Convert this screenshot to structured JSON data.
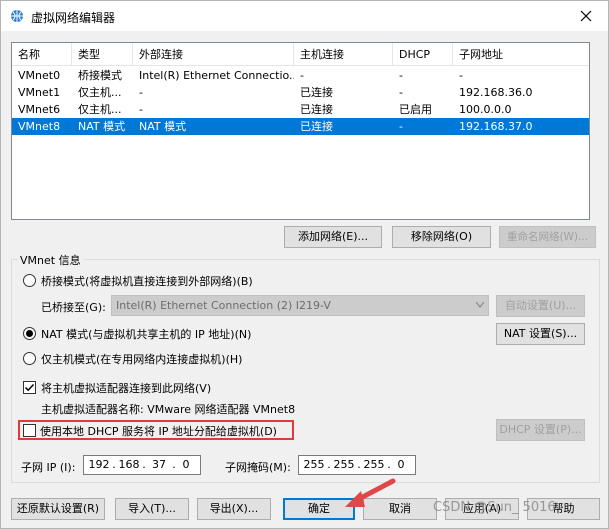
{
  "window": {
    "title": "虚拟网络编辑器"
  },
  "list": {
    "columns": [
      "名称",
      "类型",
      "外部连接",
      "主机连接",
      "DHCP",
      "子网地址"
    ],
    "rows": [
      {
        "name": "VMnet0",
        "type": "桥接模式",
        "external": "Intel(R) Ethernet Connectio...",
        "host": "-",
        "dhcp": "-",
        "subnet": "-",
        "selected": false
      },
      {
        "name": "VMnet1",
        "type": "仅主机...",
        "external": "-",
        "host": "已连接",
        "dhcp": "-",
        "subnet": "192.168.36.0",
        "selected": false
      },
      {
        "name": "VMnet6",
        "type": "仅主机...",
        "external": "-",
        "host": "已连接",
        "dhcp": "已启用",
        "subnet": "100.0.0.0",
        "selected": false
      },
      {
        "name": "VMnet8",
        "type": "NAT 模式",
        "external": "NAT 模式",
        "host": "已连接",
        "dhcp": "-",
        "subnet": "192.168.37.0",
        "selected": true
      }
    ]
  },
  "list_buttons": {
    "add": "添加网络(E)...",
    "remove": "移除网络(O)",
    "rename": "重命名网络(W)..."
  },
  "vmnet_info": {
    "group_label": "VMnet 信息",
    "bridge_radio": "桥接模式(将虚拟机直接连接到外部网络)(B)",
    "bridged_to_label": "已桥接至(G):",
    "bridged_to_value": "Intel(R) Ethernet Connection (2) I219-V",
    "auto_settings": "自动设置(U)...",
    "nat_radio": "NAT 模式(与虚拟机共享主机的 IP 地址)(N)",
    "nat_settings": "NAT 设置(S)...",
    "hostonly_radio": "仅主机模式(在专用网络内连接虚拟机)(H)",
    "connect_adapter_check": "将主机虚拟适配器连接到此网络(V)",
    "adapter_name": "主机虚拟适配器名称: VMware 网络适配器 VMnet8",
    "dhcp_check": "使用本地 DHCP 服务将 IP 地址分配给虚拟机(D)",
    "dhcp_settings": "DHCP 设置(P)...",
    "subnet_ip_label": "子网 IP (I):",
    "subnet_ip": [
      "192",
      "168",
      "37",
      "0"
    ],
    "subnet_mask_label": "子网掩码(M):",
    "subnet_mask": [
      "255",
      "255",
      "255",
      "0"
    ],
    "nat_selected": true,
    "connect_adapter_checked": true,
    "dhcp_checked": false
  },
  "footer": {
    "restore": "还原默认设置(R)",
    "import": "导入(T)...",
    "export": "导出(X)...",
    "ok": "确定",
    "cancel": "取消",
    "apply": "应用(A)",
    "help": "帮助"
  },
  "watermark": "CSDN @Sun_ 5016",
  "colors": {
    "selection": "#0078d7",
    "highlight_box": "#e03a3a",
    "arrow": "#e04848"
  }
}
